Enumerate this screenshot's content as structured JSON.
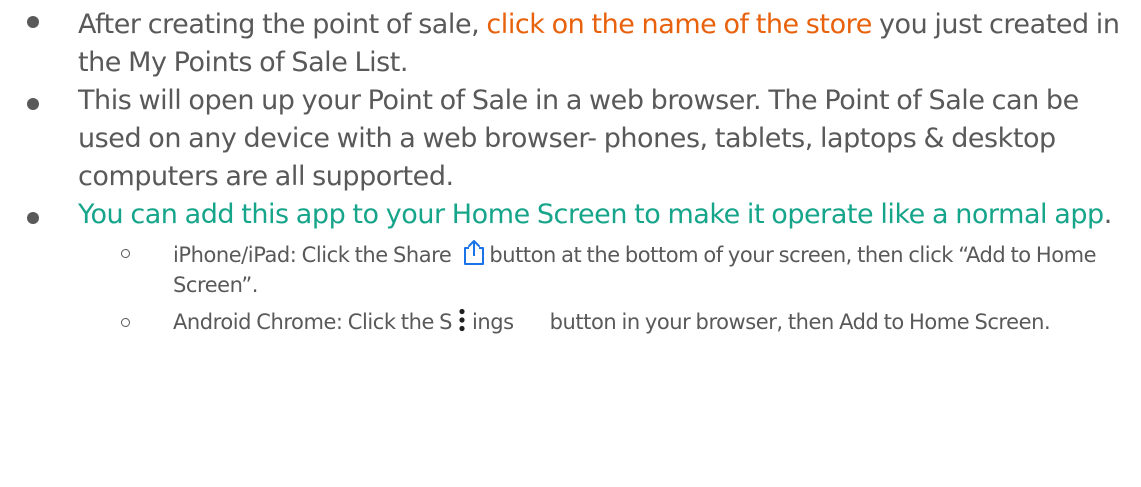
{
  "bullets": [
    {
      "pre": "After creating the point of sale, ",
      "highlight": "click on the name of the store",
      "post": " you just created in the My Points of Sale List."
    },
    {
      "text": "This will open up your Point of Sale in a web browser. The Point of Sale can be used on any device with a web browser- phones, tablets, laptops & desktop computers are all supported."
    },
    {
      "highlight": "You can add this app to your Home Screen to make it operate like a normal app",
      "post": "."
    }
  ],
  "subbullets": [
    {
      "pre": "iPhone/iPad: Click the Share",
      "icon": "share-icon",
      "post": "button at the bottom of your screen, then click “Add to Home Screen”."
    },
    {
      "pre": "Android Chrome:  Click the S",
      "icon": "kebab-menu-icon",
      "mid": "ings",
      "post": "button in your browser, then Add to Home Screen."
    }
  ],
  "colors": {
    "text": "#595959",
    "orange_link": "#e8610c",
    "teal_highlight": "#16a58a",
    "icon_blue": "#1a73e8"
  }
}
